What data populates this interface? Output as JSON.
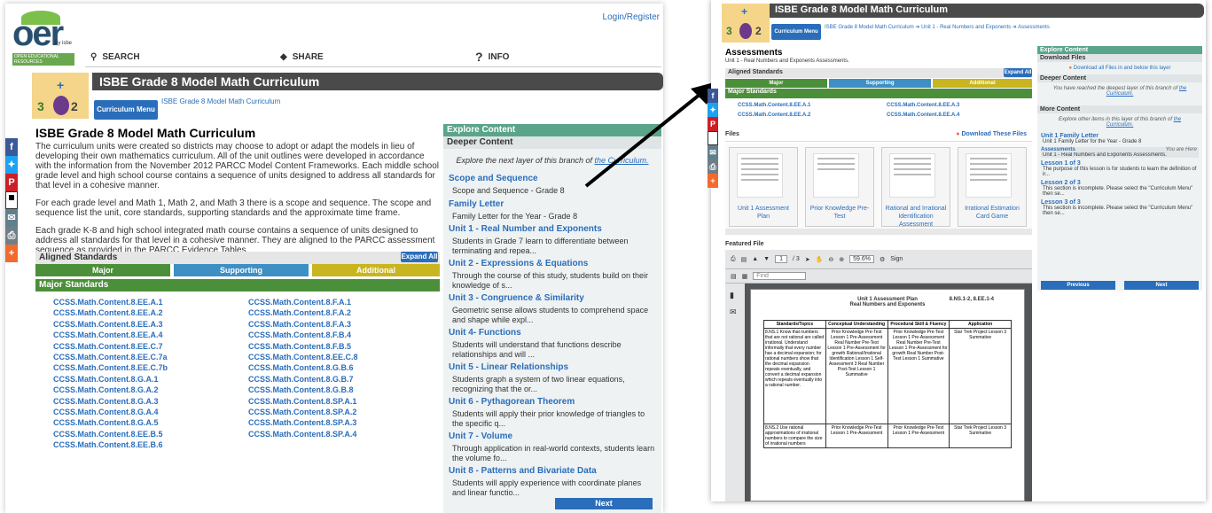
{
  "left": {
    "login": "Login/Register",
    "logo_word": "oer",
    "logo_by": "by isbe",
    "logo_sub": "OPEN EDUCATIONAL RESOURCES",
    "nav": {
      "search": "SEARCH",
      "share": "SHARE",
      "info": "INFO"
    },
    "title": "ISBE Grade 8 Model Math Curriculum",
    "breadcrumb": "ISBE Grade 8 Model Math Curriculum",
    "menu_btn": "Curriculum Menu",
    "heading": "ISBE Grade 8 Model Math Curriculum",
    "para1": "The curriculum units were created so districts may choose to adopt or adapt the models in lieu of developing their own mathematics curriculum. All of the unit outlines were developed in accordance with the information from the November 2012 PARCC Model Content Frameworks.  Each middle school grade level and high school course contains a sequence of units designed to address all standards for that level in a cohesive manner.",
    "para2": "For each grade level and Math 1, Math 2, and Math 3 there is a scope and sequence. The scope and sequence list the unit, core standards, supporting standards and the approximate time frame.",
    "para3": "Each grade K-8 and high school integrated math course contains a sequence of units designed to address all standards for that level in a cohesive manner.  They are aligned to the PARCC assessment sequence as provided in the PARCC Evidence Tables.",
    "aligned": "Aligned Standards",
    "expand": "Expand All",
    "tabs": [
      "Major",
      "Supporting",
      "Additional"
    ],
    "major_hdr": "Major Standards",
    "standards_col1": [
      "CCSS.Math.Content.8.EE.A.1",
      "CCSS.Math.Content.8.EE.A.2",
      "CCSS.Math.Content.8.EE.A.3",
      "CCSS.Math.Content.8.EE.A.4",
      "CCSS.Math.Content.8.EE.C.7",
      "CCSS.Math.Content.8.EE.C.7a",
      "CCSS.Math.Content.8.EE.C.7b",
      "CCSS.Math.Content.8.G.A.1",
      "CCSS.Math.Content.8.G.A.2",
      "CCSS.Math.Content.8.G.A.3",
      "CCSS.Math.Content.8.G.A.4",
      "CCSS.Math.Content.8.G.A.5",
      "CCSS.Math.Content.8.EE.B.5",
      "CCSS.Math.Content.8.EE.B.6"
    ],
    "standards_col2": [
      "CCSS.Math.Content.8.F.A.1",
      "CCSS.Math.Content.8.F.A.2",
      "CCSS.Math.Content.8.F.A.3",
      "CCSS.Math.Content.8.F.B.4",
      "CCSS.Math.Content.8.F.B.5",
      "CCSS.Math.Content.8.EE.C.8",
      "CCSS.Math.Content.8.G.B.6",
      "CCSS.Math.Content.8.G.B.7",
      "CCSS.Math.Content.8.G.B.8",
      "CCSS.Math.Content.8.SP.A.1",
      "CCSS.Math.Content.8.SP.A.2",
      "CCSS.Math.Content.8.SP.A.3",
      "CCSS.Math.Content.8.SP.A.4"
    ],
    "explore": {
      "header": "Explore Content",
      "deeper": "Deeper Content",
      "intro_pre": "Explore the next layer of this branch of ",
      "intro_link": "the Curriculum.",
      "items": [
        {
          "title": "Scope and Sequence",
          "desc": "Scope and Sequence - Grade 8"
        },
        {
          "title": "Family Letter",
          "desc": "Family Letter for the Year - Grade 8"
        },
        {
          "title": "Unit 1 - Real Number and Exponents",
          "desc": "Students in Grade 7 learn to differentiate between terminating and repea..."
        },
        {
          "title": "Unit 2 - Expressions & Equations",
          "desc": "Through the course of this study, students build on their knowledge of s..."
        },
        {
          "title": "Unit 3 - Congruence & Similarity",
          "desc": "Geometric sense allows students to comprehend space and shape while expl..."
        },
        {
          "title": "Unit 4- Functions",
          "desc": "Students will understand that functions describe relationships and will ..."
        },
        {
          "title": "Unit 5 - Linear Relationships",
          "desc": "Students graph a system of two linear equations, recognizing that the or..."
        },
        {
          "title": "Unit 6 - Pythagorean Theorem",
          "desc": "Students will apply their prior knowledge of triangles to the specific q..."
        },
        {
          "title": "Unit 7 - Volume",
          "desc": "Through application in real-world contexts, students learn the volume fo..."
        },
        {
          "title": "Unit 8 - Patterns and Bivariate Data",
          "desc": "Students will apply experience with coordinate planes and linear functio..."
        }
      ],
      "next": "Next"
    }
  },
  "right": {
    "title": "ISBE Grade 8 Model Math Curriculum",
    "menu_btn": "Curriculum Menu",
    "breadcrumb": "ISBE Grade 8 Model Math Curriculum ➔ Unit 1 - Real Numbers and Exponents ➔ Assessments",
    "heading": "Assessments",
    "subheading": "Unit 1 - Real Numbers and Exponents Assessments.",
    "aligned": "Aligned Standards",
    "expand": "Expand All",
    "tabs": [
      "Major",
      "Supporting",
      "Additional"
    ],
    "major_hdr": "Major Standards",
    "standards": [
      "CCSS.Math.Content.8.EE.A.1",
      "CCSS.Math.Content.8.EE.A.3",
      "CCSS.Math.Content.8.EE.A.2",
      "CCSS.Math.Content.8.EE.A.4"
    ],
    "files_hdr": "Files",
    "download_files": "Download These Files",
    "thumbs": [
      "Unit 1 Assessment Plan",
      "Prior Knowledge Pre-Test",
      "Rational and Irrational Identification Assessment",
      "Irrational Estimation Card Game"
    ],
    "featured": "Featured File",
    "pdf": {
      "page": "1",
      "pages": "/ 3",
      "zoom": "59.6%",
      "sign": "Sign",
      "find": "Find"
    },
    "doc": {
      "title": "Unit 1 Assessment Plan",
      "subtitle": "Real Numbers and Exponents",
      "codes": "8.NS.1-2, 8.EE.1-4",
      "cols": [
        "Standards/Topics",
        "Conceptual Understanding",
        "Procedural Skill & Fluency",
        "Application"
      ],
      "row1": {
        "std": "8.NS.1 Know that numbers that are not rational are called irrational. Understand informally that every number has a decimal expansion; for rational numbers show that the decimal expansion repeats eventually, and convert a decimal expansion which repeats eventually into a rational number.",
        "c1": "Prior Knowledge Pre-Test Lesson 1 Pre-Assessment  Real Number Pre-Test Lesson 1 Pre-Assessment for growth  Rational/Irrational Identification Lesson 1 Self-Assessment  3 Real Number Post-Test Lesson 1 Summative",
        "c2": "Prior Knowledge Pre-Test Lesson 1 Pre-Assessment  Real Number Pre-Test Lesson 1 Pre-Assessment for growth  Real Number Post-Test Lesson 1 Summative",
        "c3": "Star Trek Project Lesson 3 Summative"
      },
      "row2": {
        "std": "8.NS.2 Use rational approximations of irrational numbers to compare the size of irrational numbers",
        "c1": "Prior Knowledge Pre-Test Lesson 1 Pre-Assessment",
        "c2": "Prior Knowledge Pre-Test Lesson 1 Pre-Assessment",
        "c3": "Star Trek Project Lesson 3 Summative"
      }
    },
    "explore": {
      "header": "Explore Content",
      "download_hdr": "Download Files",
      "download_all": "Download all Files in and below this layer",
      "deeper_hdr": "Deeper Content",
      "deeper_text": "You have reached the deepest layer of this branch of",
      "deeper_link": "the Curriculum.",
      "more_hdr": "More Content",
      "more_text": "Explore other items in this layer of this branch of",
      "more_link": "the Curriculum.",
      "family_title": "Unit 1 Family Letter",
      "family_desc": "Unit 1 Family Letter for the Year - Grade 8",
      "assess_title": "Assessments",
      "you_are_here": "You are Here",
      "assess_desc": "Unit 1 - Real Numbers and Exponents Assessments.",
      "l1_title": "Lesson 1 of 3",
      "l1_desc": "The purpose of this lesson is for students to learn the definition of ir...",
      "l2_title": "Lesson 2 of 3",
      "l2_desc": "This section is incomplete. Please select the \"Curriculum Menu\" then se...",
      "l3_title": "Lesson 3 of 3",
      "l3_desc": "This section is incomplete. Please select the \"Curriculum Menu\" then se...",
      "prev": "Previous",
      "next": "Next"
    }
  },
  "colors": {
    "major": "#4c8f3a",
    "supporting": "#3d8fc4",
    "additional": "#c9b520",
    "explore": "#5aa58a",
    "link": "#2a6ebb",
    "title_bar": "#4a4a4a"
  },
  "social_icons": [
    "facebook-icon",
    "twitter-icon",
    "pinterest-icon",
    "delicious-icon",
    "email-icon",
    "print-icon",
    "more-icon"
  ]
}
